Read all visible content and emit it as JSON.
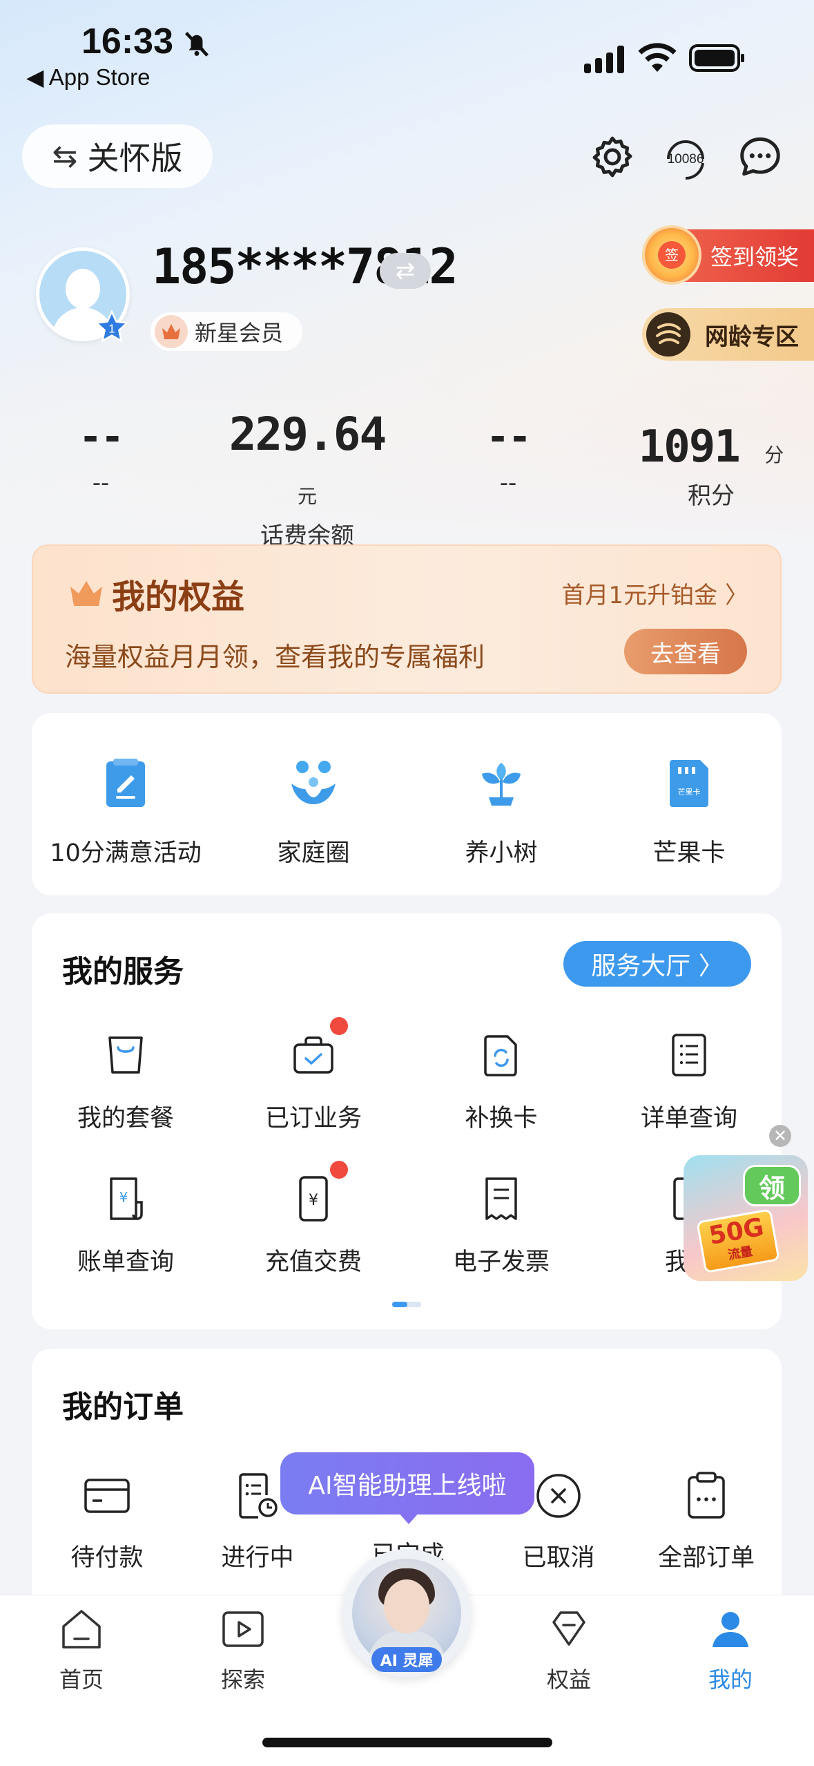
{
  "status_bar": {
    "time": "16:33",
    "back_label": "◀ App Store"
  },
  "header": {
    "care_mode_label": "关怀版",
    "care_mode_icon": "⇆",
    "service_number": "10086"
  },
  "profile": {
    "phone": "185****7812",
    "level": "1",
    "member_label": "新星会员",
    "sign_reward_label": "签到领奖",
    "sign_icon_text": "签",
    "age_zone_label": "网龄专区"
  },
  "stats": [
    {
      "value": "--",
      "unit": "",
      "label": "--"
    },
    {
      "value": "229.64",
      "unit": "元",
      "label": "话费余额"
    },
    {
      "value": "--",
      "unit": "",
      "label": "--"
    },
    {
      "value": "1091",
      "unit": "分",
      "label": "积分"
    }
  ],
  "benefits": {
    "title": "我的权益",
    "promo_link": "首月1元升铂金 〉",
    "subtitle": "海量权益月月领，查看我的专属福利",
    "button": "去查看"
  },
  "quick_tiles": [
    {
      "label": "10分满意活动",
      "icon": "edit-icon"
    },
    {
      "label": "家庭圈",
      "icon": "family-icon"
    },
    {
      "label": "养小树",
      "icon": "sprout-icon"
    },
    {
      "label": "芒果卡",
      "icon": "sim-card-icon"
    }
  ],
  "sim_card_text": "芒果卡",
  "services": {
    "title": "我的服务",
    "hall_button": "服务大厅 〉",
    "items": [
      {
        "label": "我的套餐",
        "icon": "shopping-bag-icon"
      },
      {
        "label": "已订业务",
        "icon": "briefcase-check-icon"
      },
      {
        "label": "补换卡",
        "icon": "sim-swap-icon"
      },
      {
        "label": "详单查询",
        "icon": "list-doc-icon"
      },
      {
        "label": "账单查询",
        "icon": "bill-yen-icon"
      },
      {
        "label": "充值交费",
        "icon": "phone-yen-icon"
      },
      {
        "label": "电子发票",
        "icon": "invoice-icon"
      },
      {
        "label": "我的",
        "icon": "partial-icon"
      }
    ]
  },
  "float_ad": {
    "close": "✕",
    "claim": "领",
    "amount": "50G",
    "unit": "流量"
  },
  "orders": {
    "title": "我的订单",
    "items": [
      {
        "label": "待付款",
        "icon": "card-icon"
      },
      {
        "label": "进行中",
        "icon": "doc-clock-icon"
      },
      {
        "label": "已完成",
        "icon": "done-icon"
      },
      {
        "label": "已取消",
        "icon": "cancel-circle-icon"
      },
      {
        "label": "全部订单",
        "icon": "clipboard-icon"
      }
    ]
  },
  "ai_tip": "AI智能助理上线啦",
  "ai_label": "AI 灵犀",
  "tabs": [
    {
      "label": "首页",
      "icon": "home-icon"
    },
    {
      "label": "探索",
      "icon": "play-icon"
    },
    {
      "label": "权益",
      "icon": "diamond-icon"
    },
    {
      "label": "我的",
      "icon": "person-icon",
      "active": true
    }
  ],
  "colors": {
    "accent": "#3d99ee",
    "tab_active": "#2a8ae6",
    "badge_red": "#f04a3e",
    "sign_red": "#e23b34"
  }
}
